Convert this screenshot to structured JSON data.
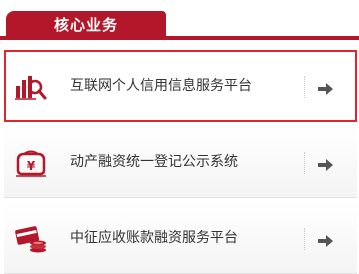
{
  "header": {
    "tab_label": "核心业务"
  },
  "services": [
    {
      "label": "互联网个人信用信息服务平台",
      "icon": "credit-report-magnifier-icon",
      "selected": true
    },
    {
      "label": "动产融资统一登记公示系统",
      "icon": "yuan-registry-icon",
      "selected": false
    },
    {
      "label": "中征应收账款融资服务平台",
      "icon": "card-coins-icon",
      "selected": false
    }
  ],
  "colors": {
    "brand_red": "#b3182a",
    "highlight_outline": "#e0252c",
    "text": "#333333",
    "arrow": "#555555"
  }
}
